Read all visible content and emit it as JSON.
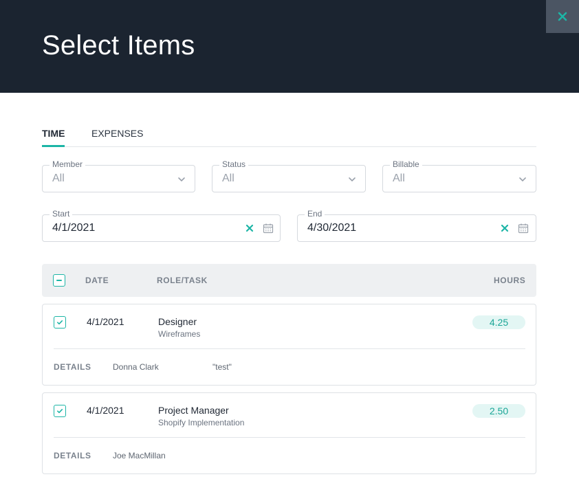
{
  "header": {
    "title": "Select Items",
    "close_icon": "close-icon"
  },
  "tabs": [
    {
      "label": "TIME",
      "active": true
    },
    {
      "label": "EXPENSES",
      "active": false
    }
  ],
  "filters": {
    "member": {
      "label": "Member",
      "value": "All"
    },
    "status": {
      "label": "Status",
      "value": "All"
    },
    "billable": {
      "label": "Billable",
      "value": "All"
    },
    "start": {
      "label": "Start",
      "value": "4/1/2021"
    },
    "end": {
      "label": "End",
      "value": "4/30/2021"
    }
  },
  "table": {
    "columns": {
      "date": "DATE",
      "role": "ROLE/TASK",
      "hours": "HOURS"
    },
    "select_all_state": "indeterminate",
    "rows": [
      {
        "checked": true,
        "date": "4/1/2021",
        "role": "Designer",
        "task": "Wireframes",
        "hours": "4.25",
        "details_label": "DETAILS",
        "member": "Donna Clark",
        "note": "\"test\""
      },
      {
        "checked": true,
        "date": "4/1/2021",
        "role": "Project Manager",
        "task": "Shopify Implementation",
        "hours": "2.50",
        "details_label": "DETAILS",
        "member": "Joe MacMillan",
        "note": ""
      }
    ]
  },
  "colors": {
    "accent": "#1cb5a6",
    "header_bg": "#1b2430",
    "close_bg": "#4b5563"
  }
}
